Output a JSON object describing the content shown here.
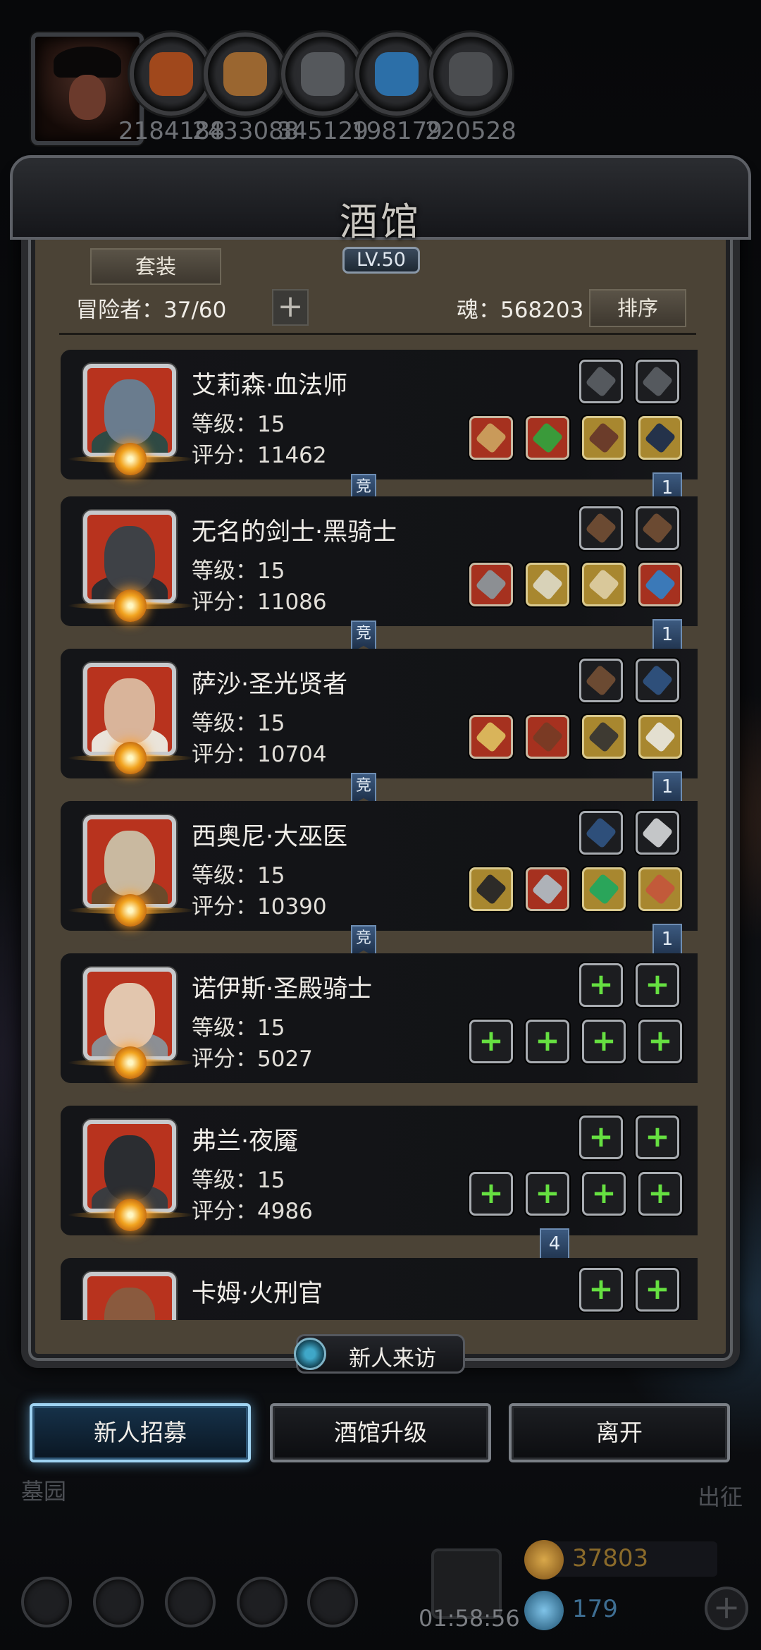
{
  "resources": [
    {
      "icon": "meat-icon",
      "value": "2184188",
      "color": "#a0481c"
    },
    {
      "icon": "wood-icon",
      "value": "2433088",
      "color": "#9a6630"
    },
    {
      "icon": "iron-icon",
      "value": "345129",
      "color": "#55585c"
    },
    {
      "icon": "crystal-icon",
      "value": "198179",
      "color": "#2c6fa8"
    },
    {
      "icon": "stone-icon",
      "value": "220528",
      "color": "#4b4d50"
    }
  ],
  "panel": {
    "title": "酒馆",
    "level": "LV.50",
    "set_button": "套装",
    "adventurer_label": "冒险者：37/60",
    "plus": "+",
    "soul_label": "魂：568203",
    "sort_button": "排序"
  },
  "heroes": [
    {
      "name": "艾莉森·血法师",
      "level": "等级：15",
      "score": "评分：11462",
      "face": "#6a7c8e",
      "body": "#2f4a44",
      "tag_left": "竞",
      "tag_right": "1",
      "top_slots": [
        {
          "cls": "dark",
          "item": "#55595e"
        },
        {
          "cls": "dark",
          "item": "#55595e"
        }
      ],
      "bottom_slots": [
        {
          "cls": "red",
          "item": "#c99a5a"
        },
        {
          "cls": "red",
          "item": "#3a9a3a"
        },
        {
          "cls": "gold",
          "item": "#6b3c2a"
        },
        {
          "cls": "gold",
          "item": "#24324a"
        }
      ]
    },
    {
      "name": "无名的剑士·黑骑士",
      "level": "等级：15",
      "score": "评分：11086",
      "face": "#3e4146",
      "body": "#2a2c30",
      "tag_left": "竞",
      "tag_right": "1",
      "top_slots": [
        {
          "cls": "dark",
          "item": "#6b4a32"
        },
        {
          "cls": "dark",
          "item": "#6b4a32"
        }
      ],
      "bottom_slots": [
        {
          "cls": "red",
          "item": "#8c8f93"
        },
        {
          "cls": "gold",
          "item": "#d8d2b8"
        },
        {
          "cls": "gold",
          "item": "#d9c89a"
        },
        {
          "cls": "red",
          "item": "#3b79b8"
        }
      ]
    },
    {
      "name": "萨沙·圣光贤者",
      "level": "等级：15",
      "score": "评分：10704",
      "face": "#d9b49a",
      "body": "#eae4da",
      "tag_left": "竞",
      "tag_right": "1",
      "top_slots": [
        {
          "cls": "dark",
          "item": "#6b4a32"
        },
        {
          "cls": "dark",
          "item": "#2e4f7a"
        }
      ],
      "bottom_slots": [
        {
          "cls": "red",
          "item": "#d9b45a"
        },
        {
          "cls": "red",
          "item": "#7a3a24"
        },
        {
          "cls": "gold",
          "item": "#3e3a32"
        },
        {
          "cls": "gold",
          "item": "#e3dfd0"
        }
      ]
    },
    {
      "name": "西奥尼·大巫医",
      "level": "等级：15",
      "score": "评分：10390",
      "face": "#c9b9a0",
      "body": "#6a4a2a",
      "tag_left": "竞",
      "tag_right": "1",
      "top_slots": [
        {
          "cls": "dark",
          "item": "#2e4f7a"
        },
        {
          "cls": "dark",
          "item": "#c4c6c8"
        }
      ],
      "bottom_slots": [
        {
          "cls": "gold",
          "item": "#2d2b28"
        },
        {
          "cls": "red",
          "item": "#aeb2b8"
        },
        {
          "cls": "gold",
          "item": "#2aa55a"
        },
        {
          "cls": "gold",
          "item": "#c25a3a"
        }
      ]
    },
    {
      "name": "诺伊斯·圣殿骑士",
      "level": "等级：15",
      "score": "评分：5027",
      "face": "#e2c6ae",
      "body": "#8c8f94",
      "tag_left": "",
      "tag_right": "",
      "top_slots": [
        {
          "cls": "dark",
          "item": ""
        },
        {
          "cls": "dark",
          "item": ""
        }
      ],
      "bottom_slots": [
        {
          "cls": "dark",
          "item": ""
        },
        {
          "cls": "dark",
          "item": ""
        },
        {
          "cls": "dark",
          "item": ""
        },
        {
          "cls": "dark",
          "item": ""
        }
      ]
    },
    {
      "name": "弗兰·夜魇",
      "level": "等级：15",
      "score": "评分：4986",
      "face": "#2b2d31",
      "body": "#3a3c40",
      "tag_left": "",
      "tag_right": "4",
      "top_slots": [
        {
          "cls": "dark",
          "item": ""
        },
        {
          "cls": "dark",
          "item": ""
        }
      ],
      "bottom_slots": [
        {
          "cls": "dark",
          "item": ""
        },
        {
          "cls": "dark",
          "item": ""
        },
        {
          "cls": "dark",
          "item": ""
        },
        {
          "cls": "dark",
          "item": ""
        }
      ]
    },
    {
      "name": "卡姆·火刑官",
      "level": "",
      "score": "",
      "face": "#8a5a3e",
      "body": "#3a2c22",
      "tag_left": "",
      "tag_right": "",
      "top_slots": [
        {
          "cls": "dark",
          "item": ""
        },
        {
          "cls": "dark",
          "item": ""
        }
      ],
      "bottom_slots": []
    }
  ],
  "empty_slot_label": "+",
  "visitor": {
    "label": "新人来访"
  },
  "buttons": {
    "recruit": "新人招募",
    "upgrade": "酒馆升级",
    "leave": "离开"
  },
  "side": {
    "left": "墓园",
    "right": "出征"
  },
  "footer": {
    "timer": "01:58:56",
    "gold": "37803",
    "gems": "179",
    "add": "+"
  }
}
